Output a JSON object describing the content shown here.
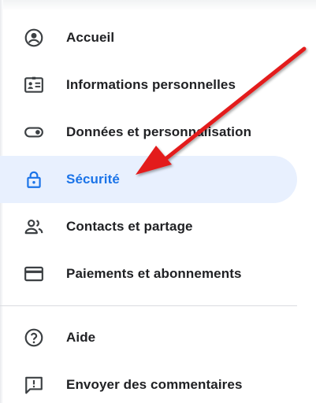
{
  "nav": {
    "items": [
      {
        "label": "Accueil",
        "icon": "account-circle-icon"
      },
      {
        "label": "Informations personnelles",
        "icon": "id-card-icon"
      },
      {
        "label": "Données et personnalisation",
        "icon": "toggle-icon"
      },
      {
        "label": "Sécurité",
        "icon": "lock-icon",
        "active": true
      },
      {
        "label": "Contacts et partage",
        "icon": "people-icon"
      },
      {
        "label": "Paiements et abonnements",
        "icon": "credit-card-icon"
      }
    ],
    "secondary": [
      {
        "label": "Aide",
        "icon": "help-circle-icon"
      },
      {
        "label": "Envoyer des commentaires",
        "icon": "feedback-icon"
      }
    ]
  },
  "colors": {
    "active_background": "#e8f0fe",
    "active_text": "#1a73e8",
    "text": "#202124",
    "icon": "#3c4043",
    "divider": "#dadce0",
    "annotation_arrow": "#e31b1b"
  }
}
